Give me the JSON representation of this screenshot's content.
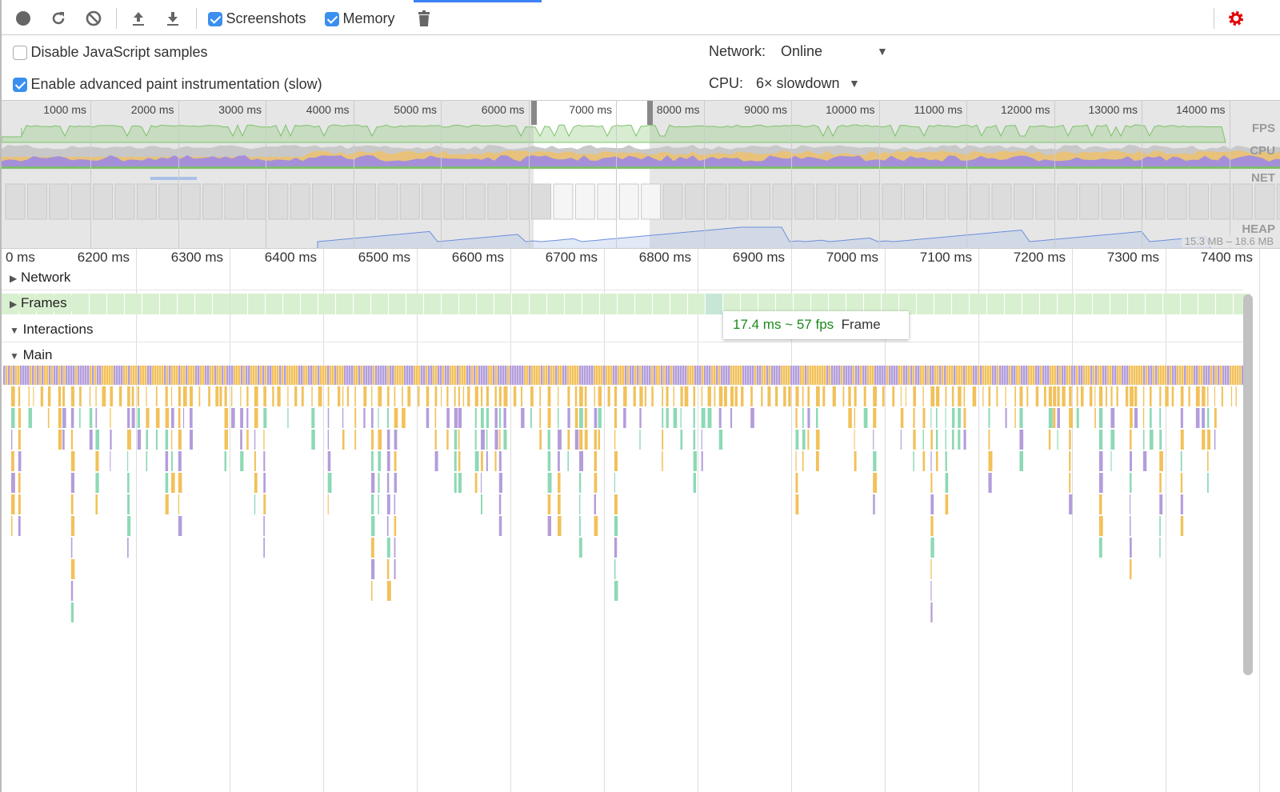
{
  "toolbar": {
    "screenshots_label": "Screenshots",
    "screenshots_checked": true,
    "memory_label": "Memory",
    "memory_checked": true,
    "icons": [
      "record-icon",
      "reload-icon",
      "clear-icon",
      "upload-icon",
      "download-icon",
      "trash-icon",
      "settings-gear-icon"
    ]
  },
  "settings": {
    "disable_js_samples": "Disable JavaScript samples",
    "disable_js_checked": false,
    "advanced_paint": "Enable advanced paint instrumentation (slow)",
    "advanced_paint_checked": true,
    "network_label": "Network:",
    "network_value": "Online",
    "cpu_label": "CPU:",
    "cpu_value": "6× slowdown"
  },
  "overview": {
    "ticks": [
      "1000 ms",
      "2000 ms",
      "3000 ms",
      "4000 ms",
      "5000 ms",
      "6000 ms",
      "7000 ms",
      "8000 ms",
      "9000 ms",
      "10000 ms",
      "11000 ms",
      "12000 ms",
      "13000 ms",
      "14000 ms"
    ],
    "tracks": {
      "fps": "FPS",
      "cpu": "CPU",
      "net": "NET",
      "heap": "HEAP"
    },
    "heap_range": "15.3 MB – 18.6 MB"
  },
  "ruler": {
    "ticks": [
      "0 ms",
      "6200 ms",
      "6300 ms",
      "6400 ms",
      "6500 ms",
      "6600 ms",
      "6700 ms",
      "6800 ms",
      "6900 ms",
      "7000 ms",
      "7100 ms",
      "7200 ms",
      "7300 ms",
      "7400 ms"
    ]
  },
  "sections": {
    "network": "Network",
    "frames": "Frames",
    "interactions": "Interactions",
    "main": "Main"
  },
  "tooltip": {
    "value": "17.4 ms ~ 57 fps",
    "label": "Frame"
  },
  "colors": {
    "scripting": "#f2c15a",
    "rendering": "#b39ddb",
    "painting": "#8dd9b5",
    "accent": "#3b8fef",
    "settings": "#e00000"
  }
}
